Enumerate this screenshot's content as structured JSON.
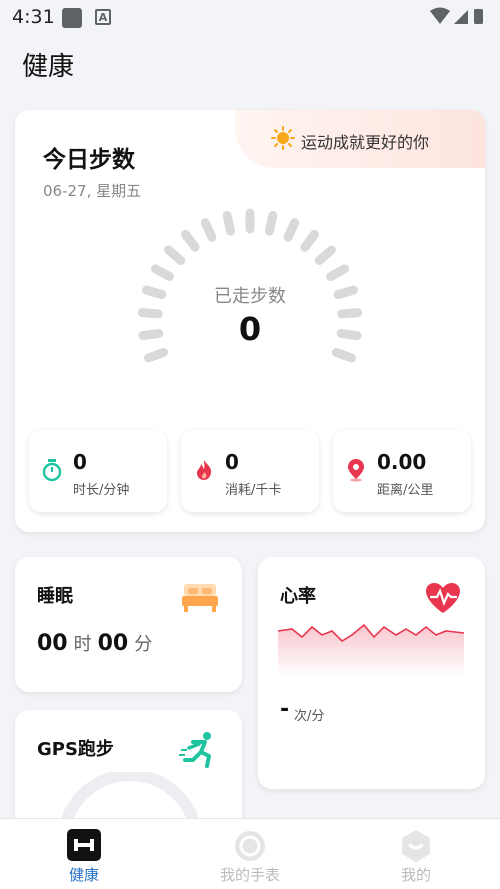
{
  "status": {
    "time": "4:31"
  },
  "header": {
    "title": "健康"
  },
  "steps": {
    "title": "今日步数",
    "date": "06-27, 星期五",
    "motto": "运动成就更好的你",
    "walked_label": "已走步数",
    "count": "0",
    "metrics": [
      {
        "value": "0",
        "label": "时长/分钟",
        "icon": "stopwatch-icon"
      },
      {
        "value": "0",
        "label": "消耗/千卡",
        "icon": "flame-icon"
      },
      {
        "value": "0.00",
        "label": "距离/公里",
        "icon": "location-pin-icon"
      }
    ]
  },
  "sleep": {
    "title": "睡眠",
    "hours": "00",
    "hour_unit": "时",
    "minutes": "00",
    "minute_unit": "分"
  },
  "heart": {
    "title": "心率",
    "value": "-",
    "unit": "次/分"
  },
  "gps": {
    "title": "GPS跑步"
  },
  "nav": {
    "items": [
      {
        "label": "健康",
        "active": true
      },
      {
        "label": "我的手表",
        "active": false
      },
      {
        "label": "我的",
        "active": false
      }
    ]
  },
  "colors": {
    "accent": "#2a73c8",
    "heart": "#e8364f",
    "green": "#1ec4a0"
  }
}
